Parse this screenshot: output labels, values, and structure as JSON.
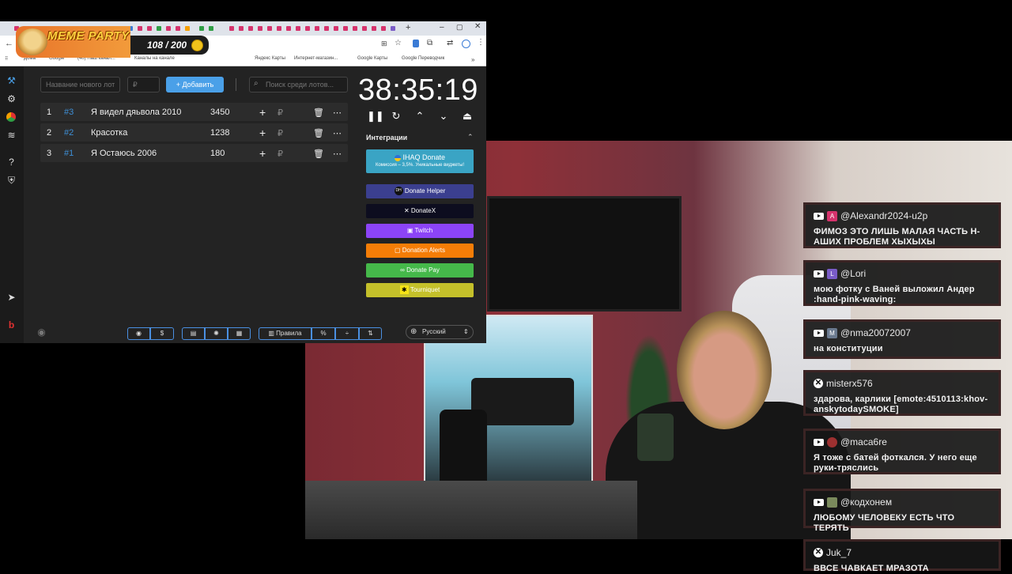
{
  "browser": {
    "bookmarks": [
      "Дома",
      "Google",
      "(40) Наш канал...",
      "Каналы на канале",
      "Яндекс Карты",
      "Интернет-магазин...",
      "Google Карты",
      "Google Переводчик"
    ]
  },
  "meme_party": {
    "title": "MEME PARTY",
    "count": "108 / 200"
  },
  "app": {
    "new_lot_placeholder": "Название нового лота",
    "currency_placeholder": "₽",
    "add_label": "Добавить",
    "search_placeholder": "Поиск среди лотов...",
    "lots": [
      {
        "index": "1",
        "id": "#3",
        "name": "Я видел дяьвола 2010",
        "amount": "3450",
        "plus": "+",
        "currency": "₽"
      },
      {
        "index": "2",
        "id": "#2",
        "name": "Красотка",
        "amount": "1238",
        "plus": "+",
        "currency": "₽"
      },
      {
        "index": "3",
        "id": "#1",
        "name": "Я Остаюсь 2006",
        "amount": "180",
        "plus": "+",
        "currency": "₽"
      }
    ],
    "timer": "38:35:19",
    "integrations_title": "Интеграции",
    "ihaq": {
      "label": "IHAQ Donate",
      "sub": "Комиссия – 3,5%. Уникальные виджеты!"
    },
    "integrations": [
      {
        "label": "Donate Helper",
        "color": "#3b3f8f"
      },
      {
        "label": "DonateX",
        "color": "#0d0d1f"
      },
      {
        "label": "Twitch",
        "color": "#8c44f7"
      },
      {
        "label": "Donation Alerts",
        "color": "#f57d07"
      },
      {
        "label": "Donate Pay",
        "color": "#45b94a"
      },
      {
        "label": "Tourniquet",
        "color": "#c4c02a"
      }
    ],
    "rules_label": "Правила",
    "language": "Русский"
  },
  "chat": [
    {
      "user": "@Alexandr2024-u2p",
      "avatar_letter": "A",
      "avatar_color": "#d6336c",
      "text": "ФИМОЗ ЭТО ЛИШЬ МАЛАЯ ЧАСТЬ Н-АШИХ ПРОБЛЕМ ХЫХЫХЫ"
    },
    {
      "user": "@Lori",
      "avatar_letter": "L",
      "avatar_color": "#7a5cc7",
      "text": "мою фотку с Ваней выложил Андер :hand-pink-waving:"
    },
    {
      "user": "@nma20072007",
      "avatar_letter": "M",
      "avatar_color": "#6b7a8f",
      "text": "на конституции"
    },
    {
      "user": "misterx576",
      "avatar_letter": "",
      "avatar_color": "",
      "text": "здарова, карлики [emote:4510113:khov-anskytodaySMOKE]"
    },
    {
      "user": "@maca6re",
      "avatar_letter": "",
      "avatar_color": "#9c3030",
      "text": "Я тоже с батей фоткался. У него еще руки-тряслись"
    },
    {
      "user": "@кодхонем",
      "avatar_letter": "",
      "avatar_color": "#7a8a5c",
      "text": "ЛЮБОМУ ЧЕЛОВЕКУ ЕСТЬ ЧТО ТЕРЯТЬ"
    },
    {
      "user": "Juk_7",
      "avatar_letter": "",
      "avatar_color": "",
      "text": "ВВСЕ ЧАВКАЕТ МРАЗОТА"
    }
  ]
}
